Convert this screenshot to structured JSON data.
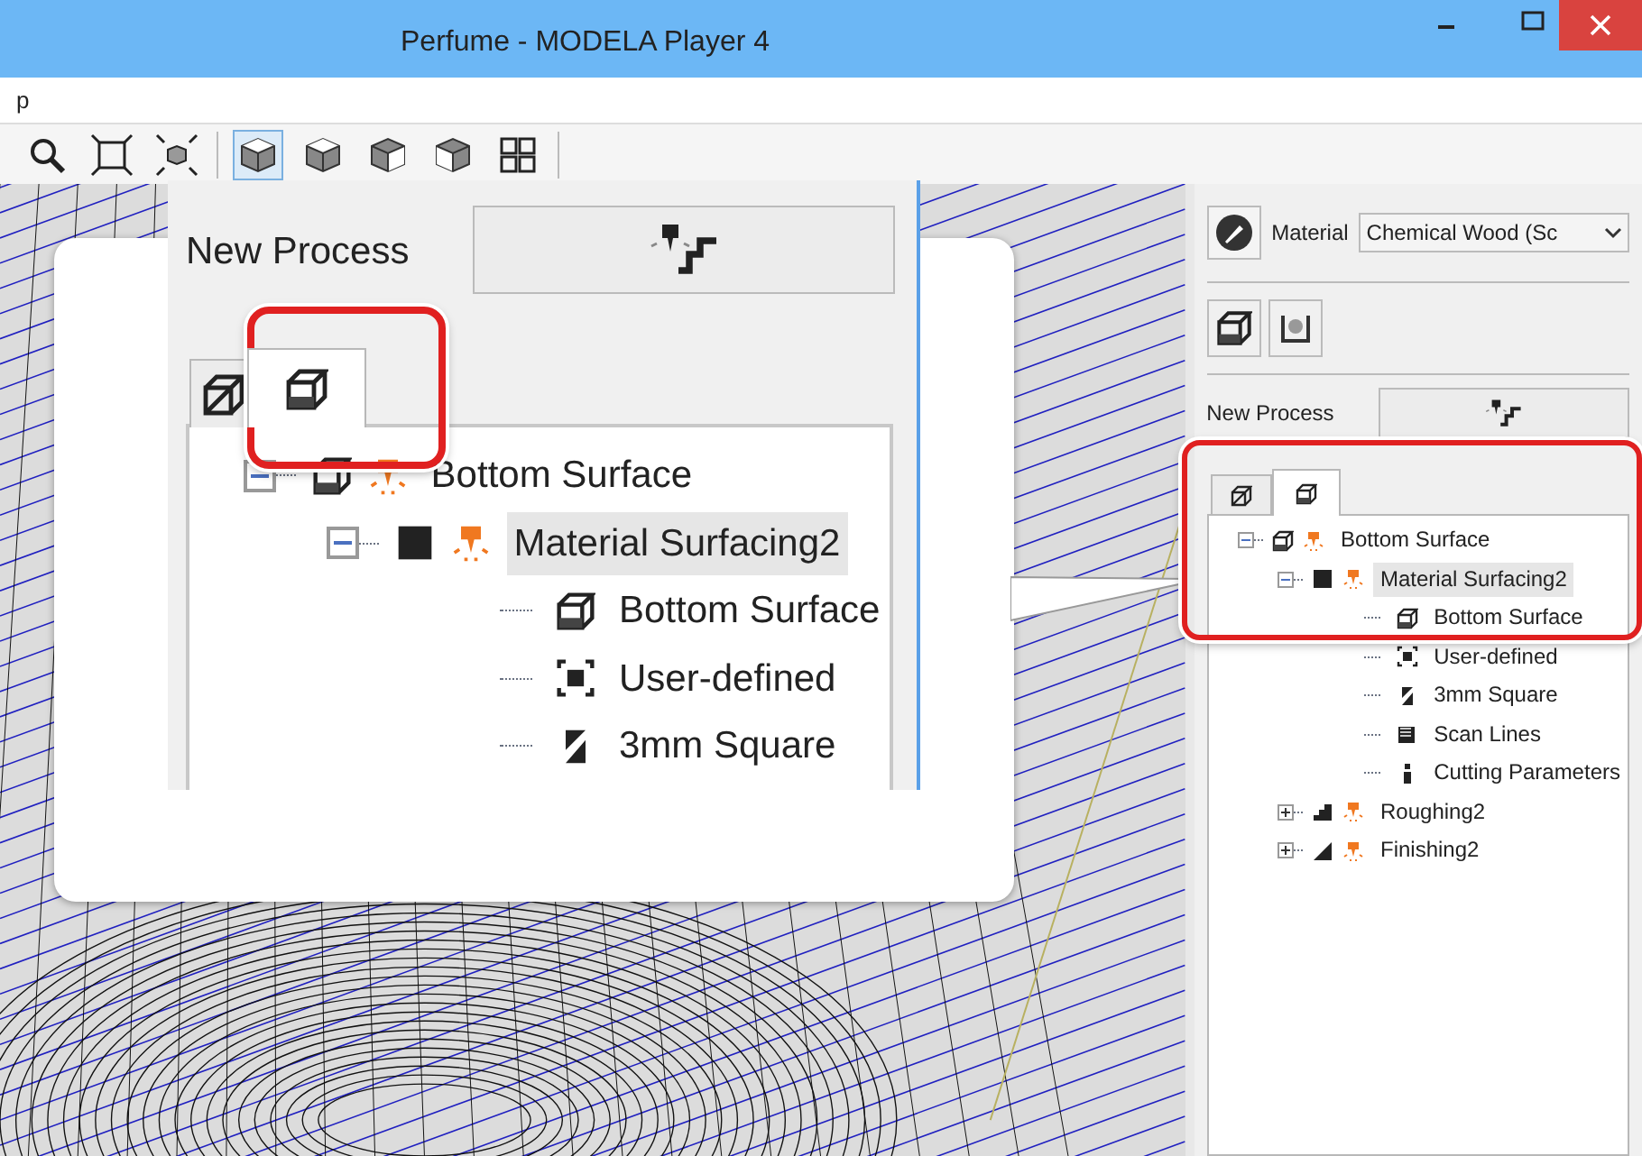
{
  "window": {
    "title": "Perfume - MODELA Player 4"
  },
  "menu_bar": {
    "items": [
      "p"
    ]
  },
  "toolbar": {
    "buttons": [
      {
        "kind": "zoom",
        "selected": false
      },
      {
        "kind": "fit",
        "selected": false
      },
      {
        "kind": "fit-model",
        "selected": false
      },
      {
        "kind": "cube-iso",
        "selected": true
      },
      {
        "kind": "cube-front",
        "selected": false
      },
      {
        "kind": "cube-right",
        "selected": false
      },
      {
        "kind": "cube-left",
        "selected": false
      },
      {
        "kind": "multi-view",
        "selected": false
      }
    ]
  },
  "panel": {
    "material_label": "Material",
    "material_value": "Chemical Wood (Sc",
    "new_process_label": "New Process",
    "tabs": [
      {
        "kind": "model",
        "selected": false
      },
      {
        "kind": "process",
        "selected": true
      }
    ],
    "tree": [
      {
        "label": "Bottom Surface",
        "kind": "model",
        "expanded": true,
        "selected": false,
        "children": [
          {
            "label": "Material Surfacing2",
            "kind": "surfacing",
            "expanded": true,
            "selected": true,
            "children": [
              {
                "label": "Bottom Surface",
                "kind": "surface",
                "selected": false
              },
              {
                "label": "User-defined",
                "kind": "area",
                "selected": false
              },
              {
                "label": "3mm Square",
                "kind": "tool",
                "selected": false
              },
              {
                "label": "Scan Lines",
                "kind": "scan",
                "selected": false
              },
              {
                "label": "Cutting Parameters",
                "kind": "params",
                "selected": false
              }
            ]
          },
          {
            "label": "Roughing2",
            "kind": "roughing",
            "expanded": false,
            "selected": false
          },
          {
            "label": "Finishing2",
            "kind": "finishing",
            "expanded": false,
            "selected": false
          }
        ]
      }
    ]
  },
  "callout": {
    "new_process_label": "New Process",
    "tabs": [
      {
        "kind": "model",
        "selected": false
      },
      {
        "kind": "process",
        "selected": true
      }
    ],
    "tree": [
      {
        "label": "Bottom Surface",
        "kind": "model",
        "expanded": true,
        "selected": false,
        "children": [
          {
            "label": "Material Surfacing2",
            "kind": "surfacing",
            "expanded": true,
            "selected": true,
            "children": [
              {
                "label": "Bottom Surface",
                "kind": "surface",
                "selected": false
              },
              {
                "label": "User-defined",
                "kind": "area",
                "selected": false
              },
              {
                "label": "3mm Square",
                "kind": "tool",
                "selected": false
              }
            ]
          }
        ]
      }
    ]
  }
}
